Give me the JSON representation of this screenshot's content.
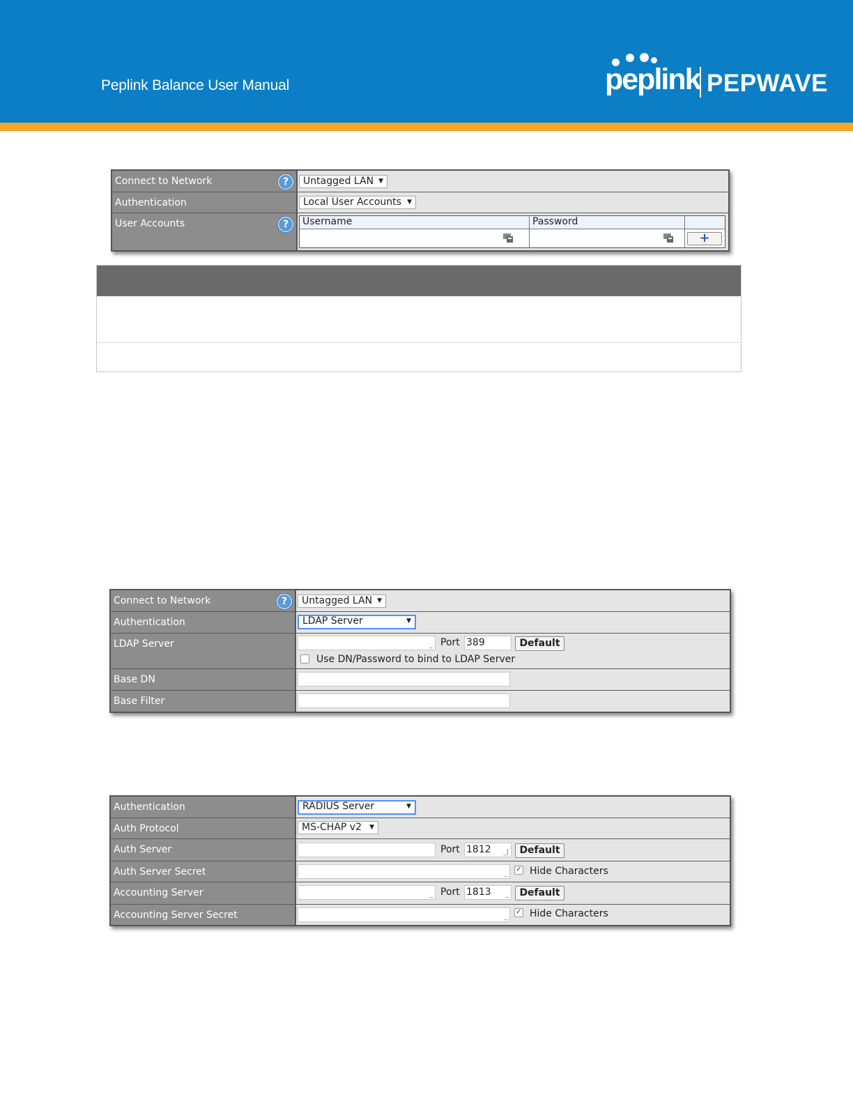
{
  "header": {
    "manual_title": "Peplink Balance User Manual",
    "logo_left": "peplink",
    "logo_right": "PEPWAVE",
    "colors": {
      "banner": "#0b7ec5",
      "stripe": "#f8a727"
    }
  },
  "form_local": {
    "connect_label": "Connect to Network",
    "connect_value": "Untagged LAN",
    "auth_label": "Authentication",
    "auth_value": "Local User Accounts",
    "accounts_label": "User Accounts",
    "username_header": "Username",
    "password_header": "Password",
    "add_button": "+"
  },
  "form_ldap": {
    "connect_label": "Connect to Network",
    "connect_value": "Untagged LAN",
    "auth_label": "Authentication",
    "auth_value": "LDAP Server",
    "ldap_label": "LDAP Server",
    "port_label": "Port",
    "port_value": "389",
    "default_button": "Default",
    "bind_checkbox_label": "Use DN/Password to bind to LDAP Server",
    "base_dn_label": "Base DN",
    "base_filter_label": "Base Filter"
  },
  "form_radius": {
    "auth_label": "Authentication",
    "auth_value": "RADIUS Server",
    "protocol_label": "Auth Protocol",
    "protocol_value": "MS-CHAP v2",
    "auth_server_label": "Auth Server",
    "port_label": "Port",
    "auth_port": "1812",
    "default_button": "Default",
    "auth_secret_label": "Auth Server Secret",
    "hide_characters": "Hide Characters",
    "acct_server_label": "Accounting Server",
    "acct_port": "1813",
    "acct_secret_label": "Accounting Server Secret"
  },
  "icons": {
    "help": "question-mark-icon",
    "dropdown": "triangle-down-icon",
    "input_helper": "keyboard-icon",
    "checkmark": "check-icon"
  }
}
